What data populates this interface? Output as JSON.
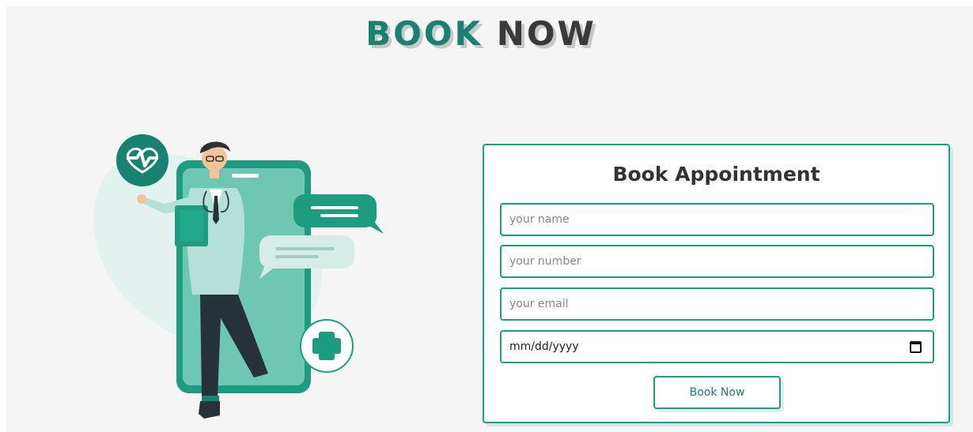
{
  "heading": {
    "accent": "BOOK",
    "rest": "NOW"
  },
  "form": {
    "title": "Book Appointment",
    "name_placeholder": "your name",
    "number_placeholder": "your number",
    "email_placeholder": "your email",
    "date_placeholder": "mm/dd/yyyy",
    "submit_label": "Book Now"
  },
  "colors": {
    "accent": "#16a085",
    "accent_dark": "#16826f",
    "text_dark": "#333333",
    "background": "#f5f5f5"
  },
  "icons": [
    "heart-pulse-icon",
    "plus-icon",
    "chat-bubble-icon",
    "calendar-icon"
  ]
}
